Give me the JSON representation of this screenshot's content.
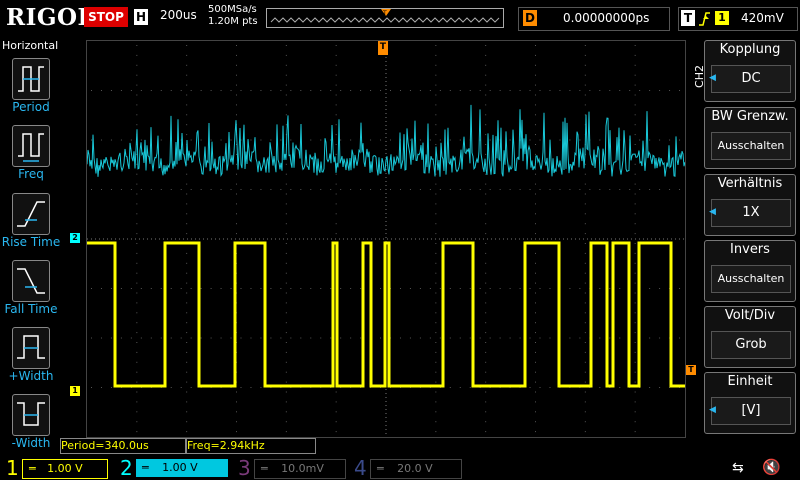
{
  "topbar": {
    "logo": "RIGOL",
    "run_state": "STOP",
    "horizontal_label": "H",
    "timebase": "200us",
    "sample_rate": "500MSa/s",
    "memory_depth": "1.20M pts",
    "delay_label": "D",
    "delay_value": "0.00000000ps",
    "trigger_label": "T",
    "trigger_source": "1",
    "trigger_level": "420mV"
  },
  "left_menu": {
    "title": "Horizontal",
    "items": [
      {
        "label": "Period",
        "icon": "period-icon"
      },
      {
        "label": "Freq",
        "icon": "frequency-icon"
      },
      {
        "label": "Rise Time",
        "icon": "rise-time-icon"
      },
      {
        "label": "Fall Time",
        "icon": "fall-time-icon"
      },
      {
        "label": "+Width",
        "icon": "positive-width-icon"
      },
      {
        "label": "-Width",
        "icon": "negative-width-icon"
      }
    ]
  },
  "right_menu": {
    "channel": "CH2",
    "items": [
      {
        "header": "Kopplung",
        "value": "DC",
        "has_arrow": true
      },
      {
        "header": "BW Grenzw.",
        "value": "Ausschalten",
        "has_arrow": false
      },
      {
        "header": "Verhältnis",
        "value": "1X",
        "has_arrow": true
      },
      {
        "header": "Invers",
        "value": "Ausschalten",
        "has_arrow": false
      },
      {
        "header": "Volt/Div",
        "value": "Grob",
        "has_arrow": false
      },
      {
        "header": "Einheit",
        "value": "[V]",
        "has_arrow": true
      }
    ]
  },
  "measurements": {
    "period": "Period=340.0us",
    "freq": "Freq=2.94kHz"
  },
  "channels": [
    {
      "num": "1",
      "scale": "1.00 V",
      "color": "#ffff00",
      "active": true
    },
    {
      "num": "2",
      "scale": "1.00 V",
      "color": "#00ffff",
      "active": true
    },
    {
      "num": "3",
      "scale": "10.0mV",
      "color": "#c040c0",
      "active": false
    },
    {
      "num": "4",
      "scale": "20.0 V",
      "color": "#3060ff",
      "active": false
    }
  ],
  "markers": {
    "ch1": "1",
    "ch2": "2",
    "trigger_position": "T",
    "trigger_level": "T"
  },
  "colors": {
    "ch1": "#ffff00",
    "ch2": "#00ffff",
    "accent": "#2ab7f0",
    "trigger": "#ff8c00",
    "stop": "#dd0000"
  }
}
